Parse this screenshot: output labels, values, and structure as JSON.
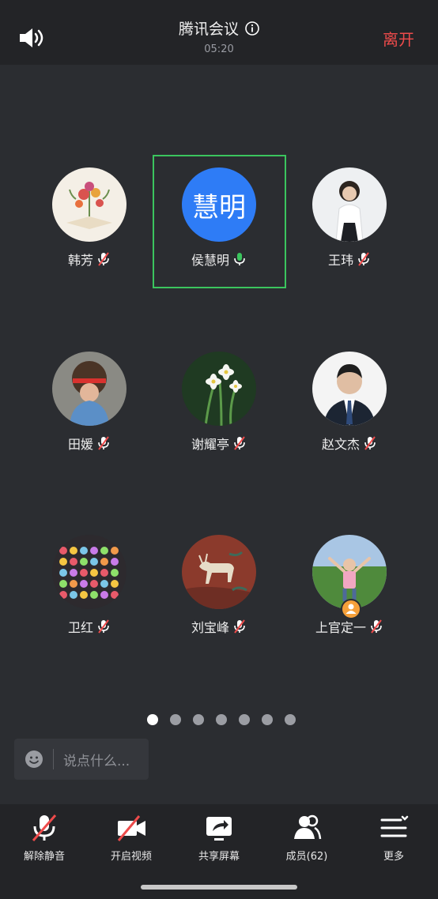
{
  "header": {
    "title": "腾讯会议",
    "timer": "05:20",
    "leave_label": "离开"
  },
  "participants": [
    {
      "name": "韩芳",
      "mic": "muted"
    },
    {
      "name": "侯慧明",
      "mic": "speaking",
      "avatar_text": "慧明",
      "avatar_color": "#2e7cf6"
    },
    {
      "name": "王玮",
      "mic": "muted"
    },
    {
      "name": "田媛",
      "mic": "muted"
    },
    {
      "name": "谢耀亭",
      "mic": "muted"
    },
    {
      "name": "赵文杰",
      "mic": "muted"
    },
    {
      "name": "卫红",
      "mic": "muted"
    },
    {
      "name": "刘宝峰",
      "mic": "muted"
    },
    {
      "name": "上官定一",
      "mic": "muted",
      "host": true
    }
  ],
  "pagination": {
    "pages": 7,
    "current": 1
  },
  "chat": {
    "placeholder": "说点什么..."
  },
  "toolbar": {
    "unmute": "解除静音",
    "start_video": "开启视频",
    "share_screen": "共享屏幕",
    "members": "成员(62)",
    "more": "更多"
  },
  "colors": {
    "accent_active": "#3bc55e",
    "leave": "#ee4b4b",
    "background": "#2b2d31",
    "bar": "#232427"
  }
}
